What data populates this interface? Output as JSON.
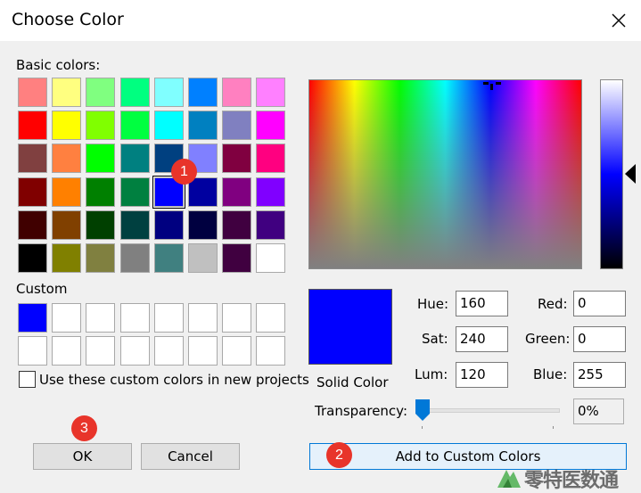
{
  "window": {
    "title": "Choose Color"
  },
  "basic_colors": {
    "label": "Basic colors:",
    "swatches": [
      "#ff8080",
      "#ffff80",
      "#80ff80",
      "#00ff80",
      "#80ffff",
      "#0080ff",
      "#ff80c0",
      "#ff80ff",
      "#ff0000",
      "#ffff00",
      "#80ff00",
      "#00ff40",
      "#00ffff",
      "#0080c0",
      "#8080c0",
      "#ff00ff",
      "#804040",
      "#ff8040",
      "#00ff00",
      "#008080",
      "#004080",
      "#8080ff",
      "#800040",
      "#ff0080",
      "#800000",
      "#ff8000",
      "#008000",
      "#008040",
      "#0000ff",
      "#0000a0",
      "#800080",
      "#8000ff",
      "#400000",
      "#804000",
      "#004000",
      "#004040",
      "#000080",
      "#000040",
      "#400040",
      "#400080",
      "#000000",
      "#808000",
      "#808040",
      "#808080",
      "#408080",
      "#c0c0c0",
      "#400040",
      "#ffffff"
    ],
    "selected_index": 28
  },
  "custom_colors": {
    "label": "Custom",
    "swatches": [
      "#0000ff",
      "#ffffff",
      "#ffffff",
      "#ffffff",
      "#ffffff",
      "#ffffff",
      "#ffffff",
      "#ffffff",
      "#ffffff",
      "#ffffff",
      "#ffffff",
      "#ffffff",
      "#ffffff",
      "#ffffff",
      "#ffffff",
      "#ffffff"
    ]
  },
  "use_custom_checkbox": {
    "label": "Use these custom colors in new projects",
    "checked": false
  },
  "preview": {
    "label": "Solid Color",
    "color": "#0000ff"
  },
  "fields": {
    "hue": {
      "label": "Hue:",
      "value": "160"
    },
    "sat": {
      "label": "Sat:",
      "value": "240"
    },
    "lum": {
      "label": "Lum:",
      "value": "120"
    },
    "red": {
      "label": "Red:",
      "value": "0"
    },
    "green": {
      "label": "Green:",
      "value": "0"
    },
    "blue": {
      "label": "Blue:",
      "value": "255"
    }
  },
  "transparency": {
    "label": "Transparency:",
    "value": "0%"
  },
  "buttons": {
    "ok": "OK",
    "cancel": "Cancel",
    "add_custom": "Add to Custom Colors"
  },
  "annotations": [
    "1",
    "2",
    "3"
  ],
  "watermark": {
    "text": "零特医数通"
  }
}
